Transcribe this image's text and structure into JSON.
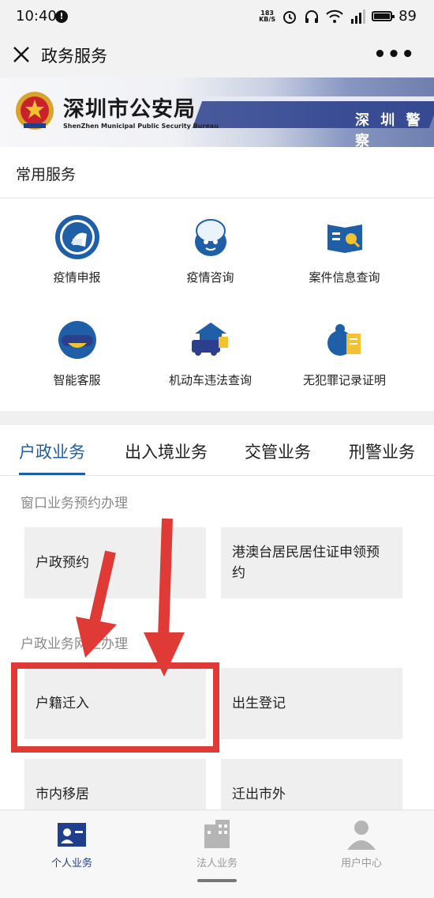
{
  "status_bar": {
    "time": "10:40",
    "net_speed_top": "183",
    "net_speed_bottom": "KB/S",
    "battery": "89"
  },
  "title_bar": {
    "title": "政务服务",
    "more": "•••"
  },
  "banner": {
    "name": "深圳市公安局",
    "english_name": "ShenZhen Municipal Public Security Bureau",
    "sign_text": "深 圳 警 察"
  },
  "common_services": {
    "heading": "常用服务",
    "items": [
      {
        "label": "疫情申报",
        "icon": "mask-person-icon"
      },
      {
        "label": "疫情咨询",
        "icon": "mascot-icon"
      },
      {
        "label": "案件信息查询",
        "icon": "book-search-icon"
      },
      {
        "label": "智能客服",
        "icon": "robot-service-icon"
      },
      {
        "label": "机动车违法查询",
        "icon": "car-house-icon"
      },
      {
        "label": "无犯罪记录证明",
        "icon": "certificate-icon"
      }
    ]
  },
  "tabs": [
    {
      "label": "户政业务",
      "active": true
    },
    {
      "label": "出入境业务",
      "active": false
    },
    {
      "label": "交管业务",
      "active": false
    },
    {
      "label": "刑警业务",
      "active": false
    }
  ],
  "window_section": {
    "heading": "窗口业务预约办理",
    "cards": [
      "户政预约",
      "港澳台居民居住证申领预约"
    ]
  },
  "online_section": {
    "heading": "户政业务网上办理",
    "cards": [
      "户籍迁入",
      "出生登记",
      "市内移居",
      "迁出市外"
    ]
  },
  "bottom_nav": [
    {
      "label": "个人业务",
      "icon": "person-card-icon",
      "active": true
    },
    {
      "label": "法人业务",
      "icon": "building-icon",
      "active": false
    },
    {
      "label": "用户中心",
      "icon": "user-icon",
      "active": false
    }
  ],
  "colors": {
    "accent": "#1f5fa8",
    "annotation_red": "#e03a36",
    "card_bg": "#efefef"
  }
}
